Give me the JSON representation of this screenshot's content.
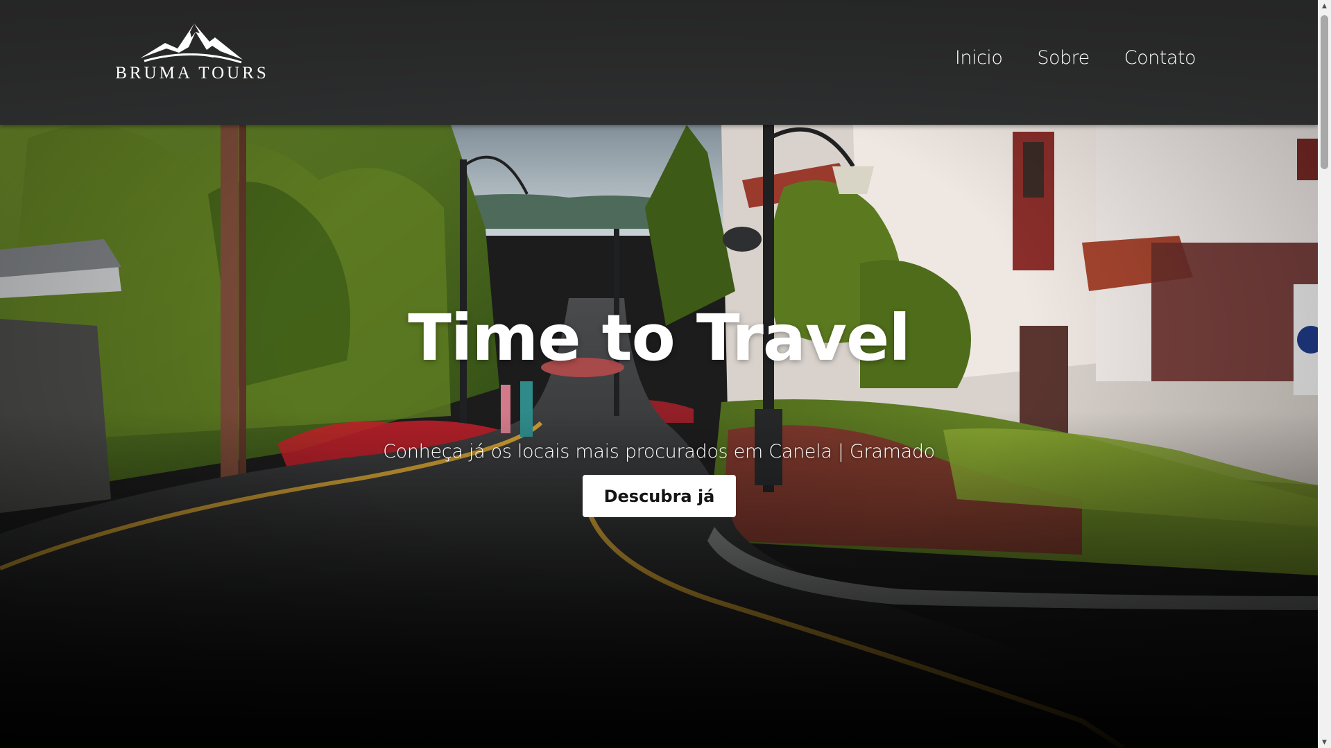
{
  "brand": {
    "name": "BRUMA TOURS",
    "logo_icon": "mountain-icon"
  },
  "nav": {
    "items": [
      {
        "label": "Inicio"
      },
      {
        "label": "Sobre"
      },
      {
        "label": "Contato"
      }
    ]
  },
  "hero": {
    "title": "Time to Travel",
    "subtitle": "Conheça já os locais mais procurados em Canela | Gramado",
    "cta_label": "Descubra já"
  },
  "scrollbar": {
    "up_icon": "▲",
    "down_icon": "▼"
  },
  "colors": {
    "header_bg": "#262626",
    "text": "#ffffff",
    "button_bg": "#ffffff",
    "button_text": "#151515"
  }
}
